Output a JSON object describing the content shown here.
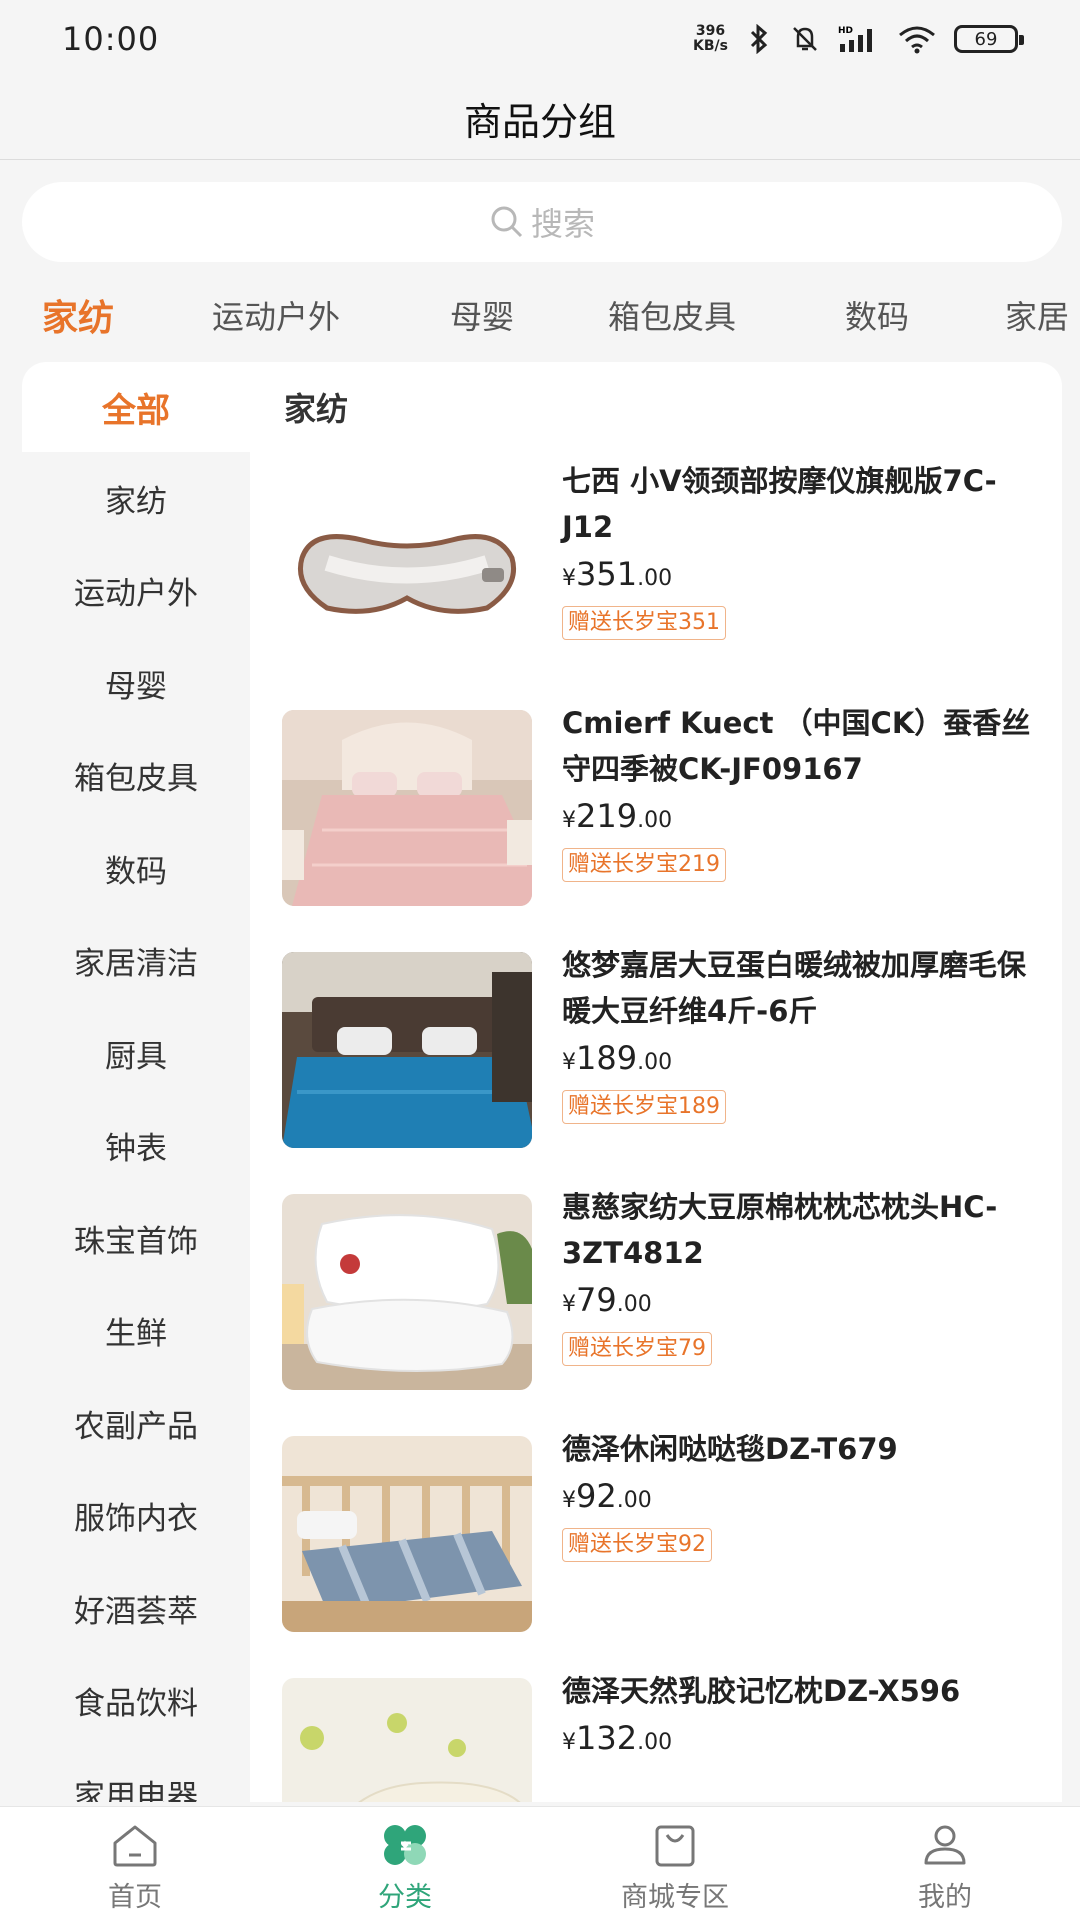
{
  "status_bar": {
    "time": "10:00",
    "net_speed_value": "396",
    "net_speed_unit": "KB/s",
    "battery": "69",
    "icons": [
      "bluetooth-icon",
      "mute-icon",
      "hd-signal-icon",
      "wifi-icon",
      "battery-icon"
    ]
  },
  "header": {
    "title": "商品分组"
  },
  "search": {
    "placeholder": "搜索"
  },
  "top_tabs": [
    {
      "label": "家纺",
      "active": true
    },
    {
      "label": "运动户外"
    },
    {
      "label": "母婴"
    },
    {
      "label": "箱包皮具"
    },
    {
      "label": "数码"
    },
    {
      "label": "家居"
    }
  ],
  "sidebar": {
    "all_label": "全部",
    "items": [
      "家纺",
      "运动户外",
      "母婴",
      "箱包皮具",
      "数码",
      "家居清洁",
      "厨具",
      "钟表",
      "珠宝首饰",
      "生鲜",
      "农副产品",
      "服饰内衣",
      "好酒荟萃",
      "食品饮料",
      "家用电器"
    ]
  },
  "main": {
    "section_title": "家纺",
    "products": [
      {
        "name": "七西 小V领颈部按摩仪旗舰版7C-J12",
        "currency": "¥",
        "price_int": "351",
        "price_dec": ".00",
        "gift": "赠送长岁宝351",
        "image": "neck-massager-image"
      },
      {
        "name": "Cmierf Kuect （中国CK）蚕香丝守四季被CK-JF09167",
        "currency": "¥",
        "price_int": "219",
        "price_dec": ".00",
        "gift": "赠送长岁宝219",
        "image": "pink-quilt-image"
      },
      {
        "name": "悠梦嘉居大豆蛋白暖绒被加厚磨毛保暖大豆纤维4斤-6斤",
        "currency": "¥",
        "price_int": "189",
        "price_dec": ".00",
        "gift": "赠送长岁宝189",
        "image": "blue-quilt-image"
      },
      {
        "name": "惠慈家纺大豆原棉枕枕芯枕头HC-3ZT4812",
        "currency": "¥",
        "price_int": "79",
        "price_dec": ".00",
        "gift": "赠送长岁宝79",
        "image": "pillow-image"
      },
      {
        "name": "德泽休闲哒哒毯DZ-T679",
        "currency": "¥",
        "price_int": "92",
        "price_dec": ".00",
        "gift": "赠送长岁宝92",
        "image": "blanket-image"
      },
      {
        "name": "德泽天然乳胶记忆枕DZ-X596",
        "currency": "¥",
        "price_int": "132",
        "price_dec": ".00",
        "gift": "",
        "image": "latex-pillow-image"
      }
    ]
  },
  "bottom_nav": [
    {
      "label": "首页",
      "icon": "home-icon"
    },
    {
      "label": "分类",
      "icon": "category-icon",
      "active": true
    },
    {
      "label": "商城专区",
      "icon": "shopping-bag-icon"
    },
    {
      "label": "我的",
      "icon": "profile-icon"
    }
  ],
  "colors": {
    "accent": "#e8742a",
    "nav_active": "#2fa57a",
    "background": "#f5f5f5"
  }
}
